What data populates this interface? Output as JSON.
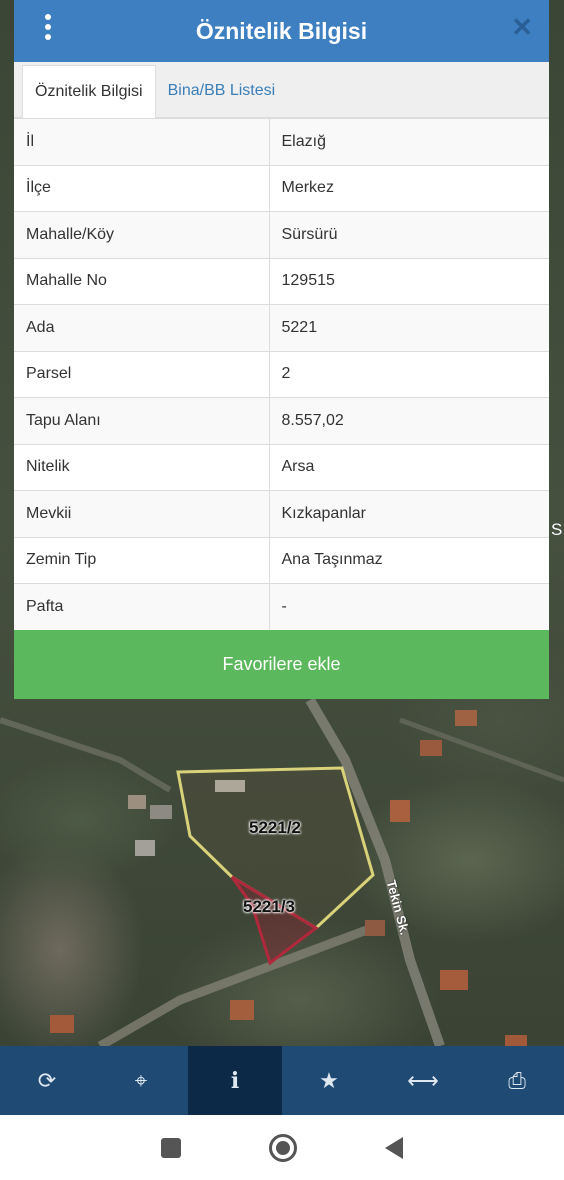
{
  "dialog": {
    "title": "Öznitelik Bilgisi",
    "close_symbol": "✕",
    "tabs": [
      {
        "label": "Öznitelik Bilgisi",
        "active": true
      },
      {
        "label": "Bina/BB Listesi",
        "active": false
      }
    ],
    "rows": [
      {
        "key": "İl",
        "value": "Elazığ"
      },
      {
        "key": "İlçe",
        "value": "Merkez"
      },
      {
        "key": "Mahalle/Köy",
        "value": "Sürsürü"
      },
      {
        "key": "Mahalle No",
        "value": "129515"
      },
      {
        "key": "Ada",
        "value": "5221"
      },
      {
        "key": "Parsel",
        "value": "2"
      },
      {
        "key": "Tapu Alanı",
        "value": "8.557,02"
      },
      {
        "key": "Nitelik",
        "value": "Arsa"
      },
      {
        "key": "Mevkii",
        "value": "Kızkapanlar"
      },
      {
        "key": "Zemin Tip",
        "value": "Ana Taşınmaz"
      },
      {
        "key": "Pafta",
        "value": "-"
      }
    ],
    "favorite_button": "Favorilere ekle"
  },
  "map": {
    "parcel_1": "5221/2",
    "parcel_2": "5221/3",
    "street": "Tekin Sk.",
    "edge_letter": "S"
  },
  "toolbar": {
    "items": [
      {
        "name": "refresh-icon",
        "glyph": "⟳"
      },
      {
        "name": "locate-icon",
        "glyph": "⌖"
      },
      {
        "name": "info-icon",
        "glyph": "i"
      },
      {
        "name": "star-icon",
        "glyph": "★"
      },
      {
        "name": "measure-icon",
        "glyph": "⟷"
      },
      {
        "name": "print-icon",
        "glyph": "⎙"
      }
    ],
    "active_index": 2
  },
  "colors": {
    "header": "#3d7fc1",
    "favorite_button": "#5cb85c",
    "toolbar": "#1f4a74",
    "toolbar_active": "#0c2a47",
    "parcel_1_outline": "#d8d27a",
    "parcel_2_outline": "#b0283c"
  }
}
